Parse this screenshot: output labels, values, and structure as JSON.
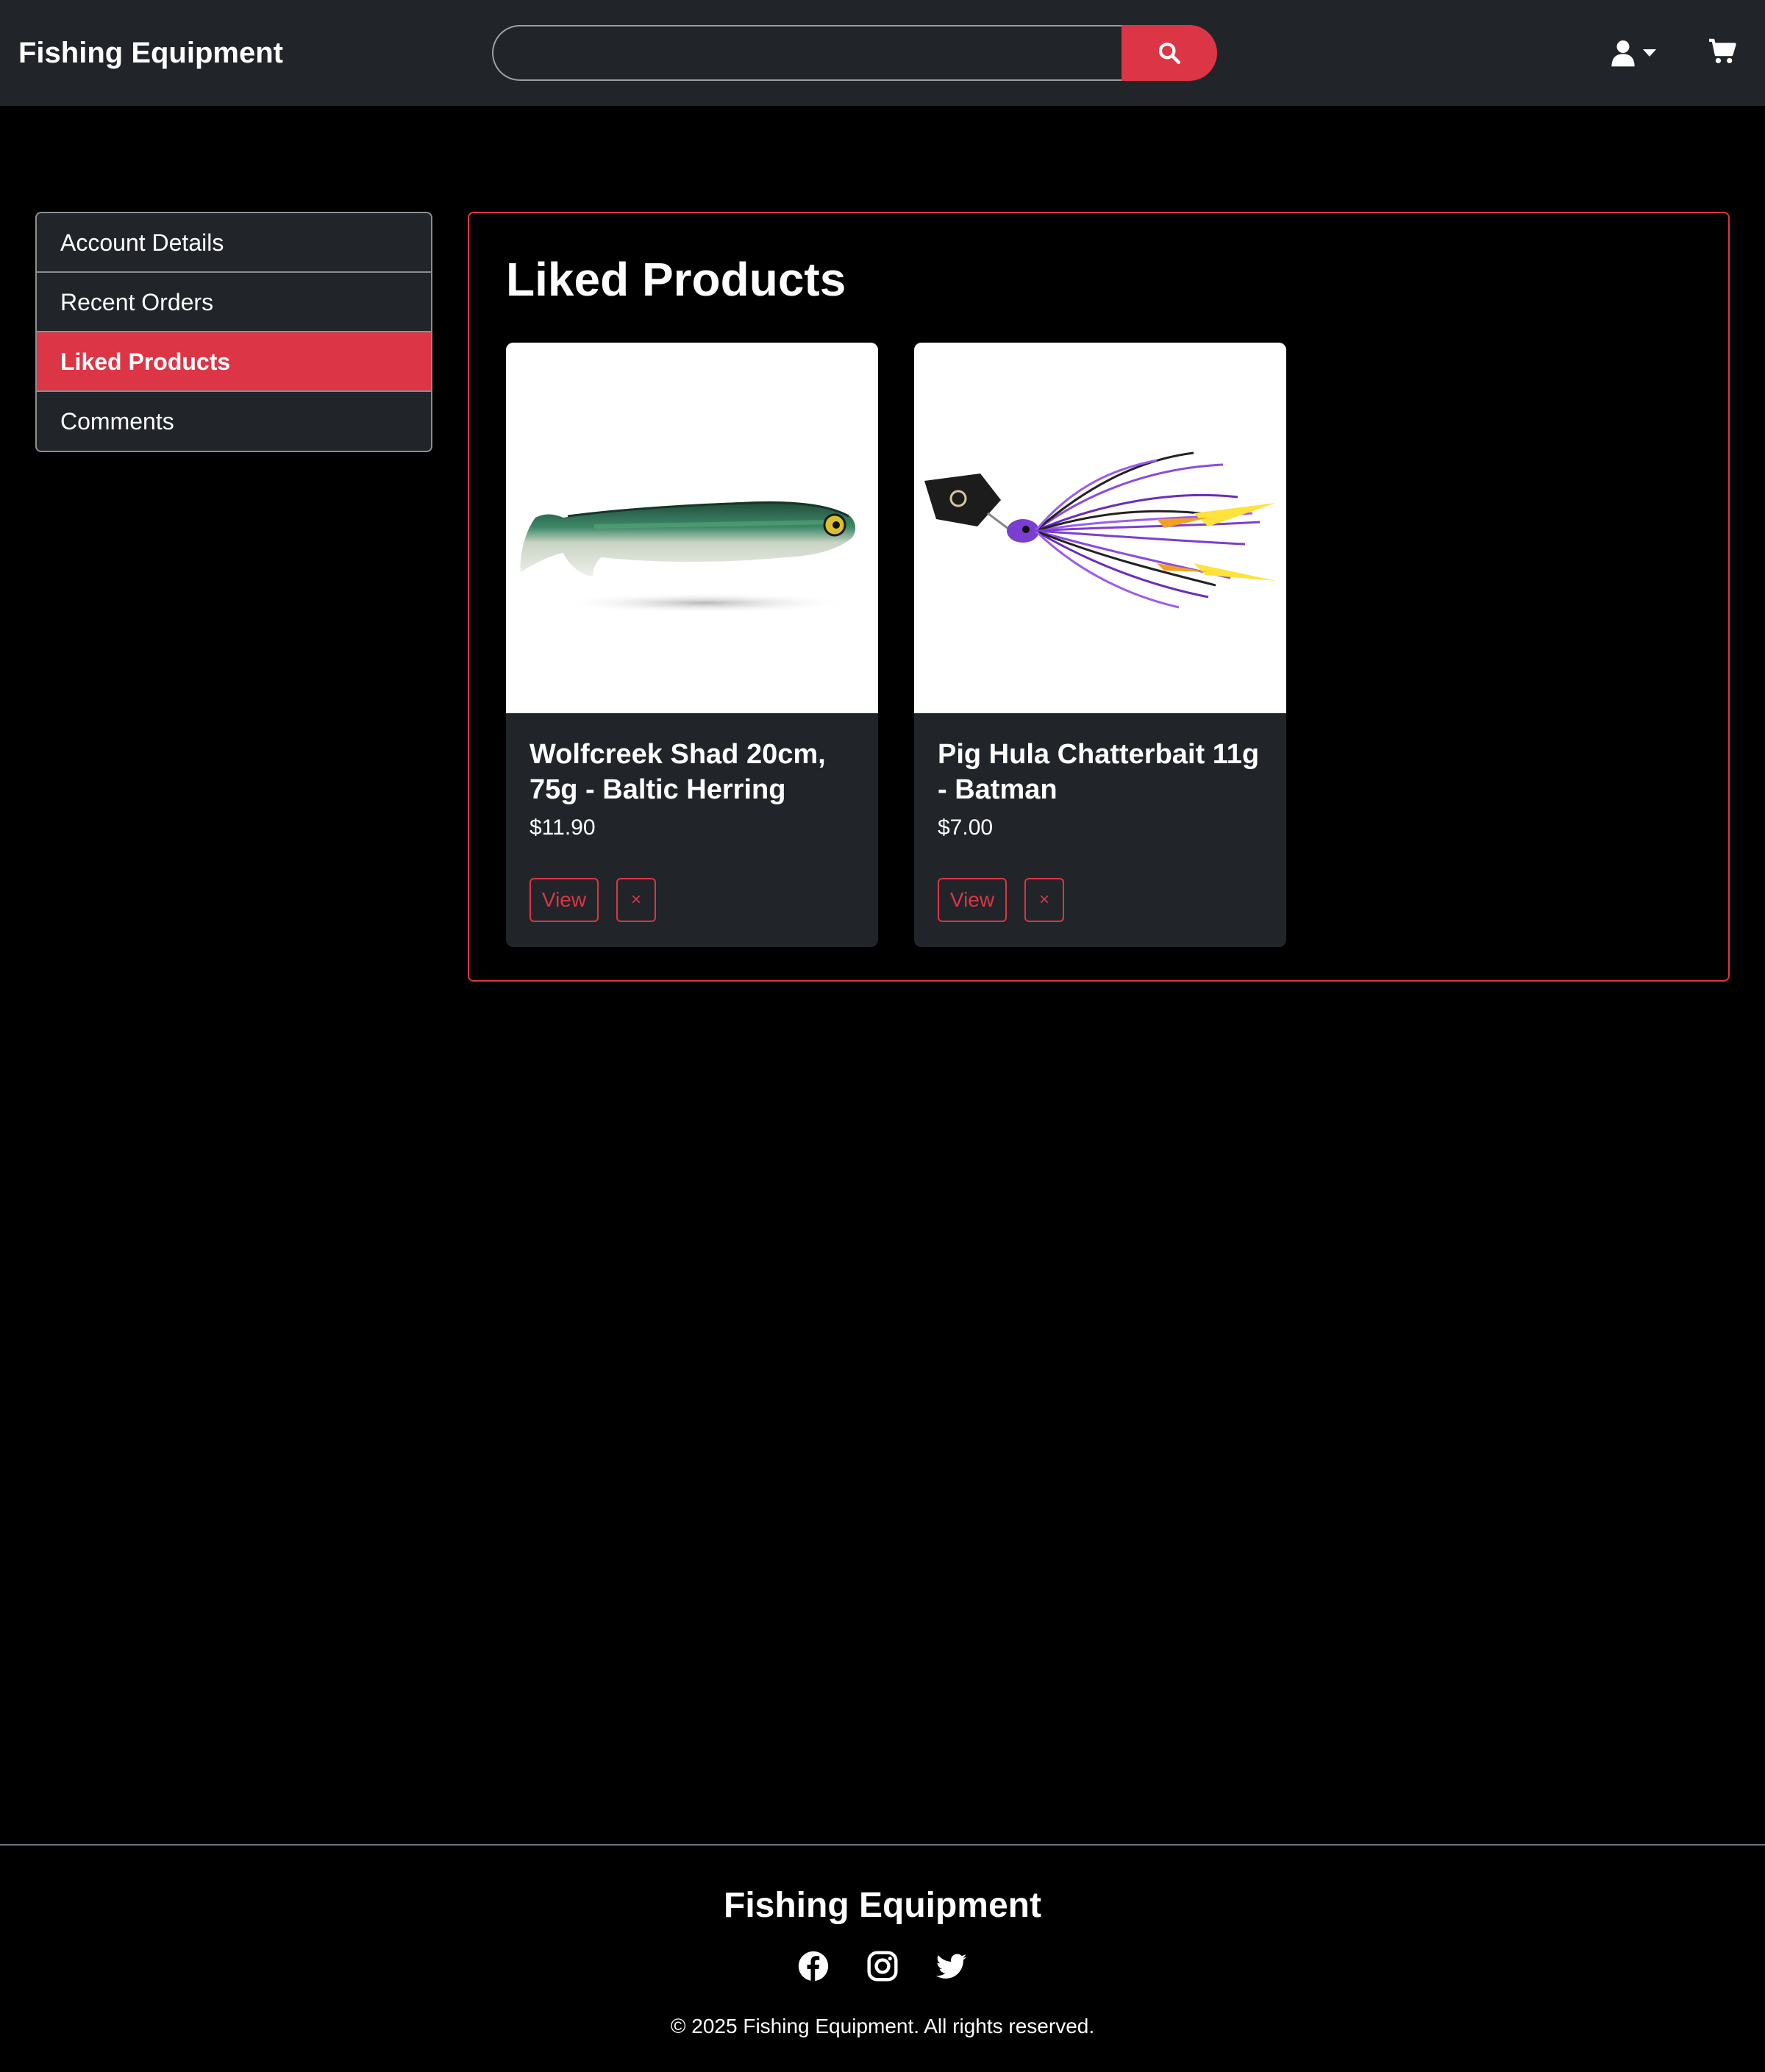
{
  "header": {
    "brand": "Fishing Equipment",
    "search": {
      "value": "",
      "placeholder": ""
    },
    "icons": [
      "search-icon",
      "user-icon",
      "caret-down-icon",
      "cart-icon"
    ]
  },
  "sidebar": {
    "items": [
      {
        "label": "Account Details"
      },
      {
        "label": "Recent Orders"
      },
      {
        "label": "Liked Products",
        "active": true
      },
      {
        "label": "Comments"
      }
    ]
  },
  "main": {
    "title": "Liked Products",
    "products": [
      {
        "name": "Wolfcreek Shad 20cm, 75g - Baltic Herring",
        "price": "$11.90",
        "view_label": "View",
        "remove_label": "×"
      },
      {
        "name": "Pig Hula Chatterbait 11g - Batman",
        "price": "$7.00",
        "view_label": "View",
        "remove_label": "×"
      }
    ]
  },
  "footer": {
    "brand": "Fishing Equipment",
    "socials": [
      "facebook-icon",
      "instagram-icon",
      "twitter-icon"
    ],
    "copyright": "© 2025 Fishing Equipment. All rights reserved."
  },
  "colors": {
    "accent": "#dc3545",
    "navbar": "#212529",
    "background": "#000000"
  }
}
